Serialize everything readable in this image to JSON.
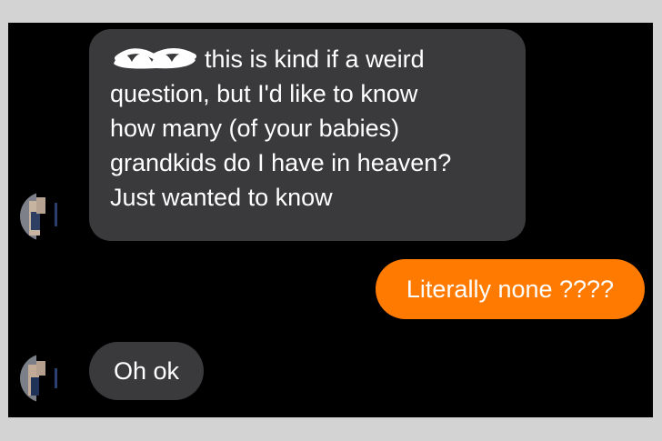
{
  "conversation": {
    "messages": [
      {
        "sender": "contact",
        "lines": [
          "this is kind if a weird",
          "question, but I'd like to know",
          "how many (of your babies)",
          "grandkids do I have in heaven?",
          "Just wanted to know"
        ]
      },
      {
        "sender": "me",
        "text": "Literally none ????"
      },
      {
        "sender": "contact",
        "text": "Oh ok"
      }
    ]
  },
  "colors": {
    "frame": "#d3d3d3",
    "background": "#000000",
    "incoming_bubble": "#3a3a3c",
    "outgoing_bubble": "#ff7a00",
    "text": "#ffffff",
    "redaction": "#ffffff"
  },
  "icons": {
    "redaction": "scribble-redaction-icon",
    "avatar": "contact-avatar"
  }
}
